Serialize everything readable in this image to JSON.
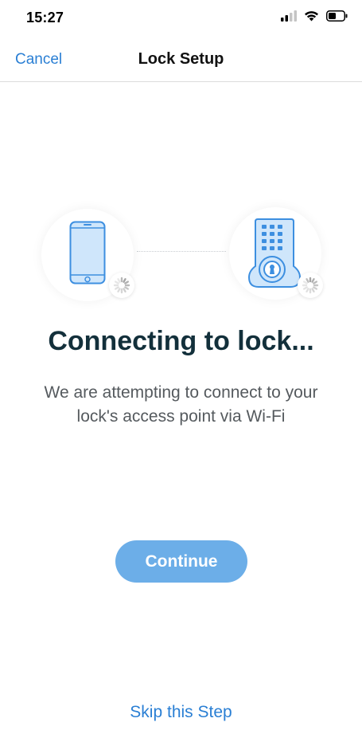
{
  "status_bar": {
    "time": "15:27"
  },
  "nav": {
    "cancel_label": "Cancel",
    "title": "Lock Setup"
  },
  "illustration": {
    "phone_icon": "phone-icon",
    "lock_icon": "deadbolt-lock-icon",
    "spinner_icon": "loading-spinner-icon"
  },
  "main": {
    "heading": "Connecting to lock...",
    "subtitle": "We are attempting to connect to your lock's access point via Wi-Fi"
  },
  "actions": {
    "continue_label": "Continue",
    "skip_label": "Skip this Step"
  },
  "colors": {
    "accent": "#2a7fd4",
    "button_disabled": "#6caee8",
    "heading": "#13303b",
    "device_fill": "#cfe6fb",
    "device_stroke": "#3d8fe0"
  }
}
